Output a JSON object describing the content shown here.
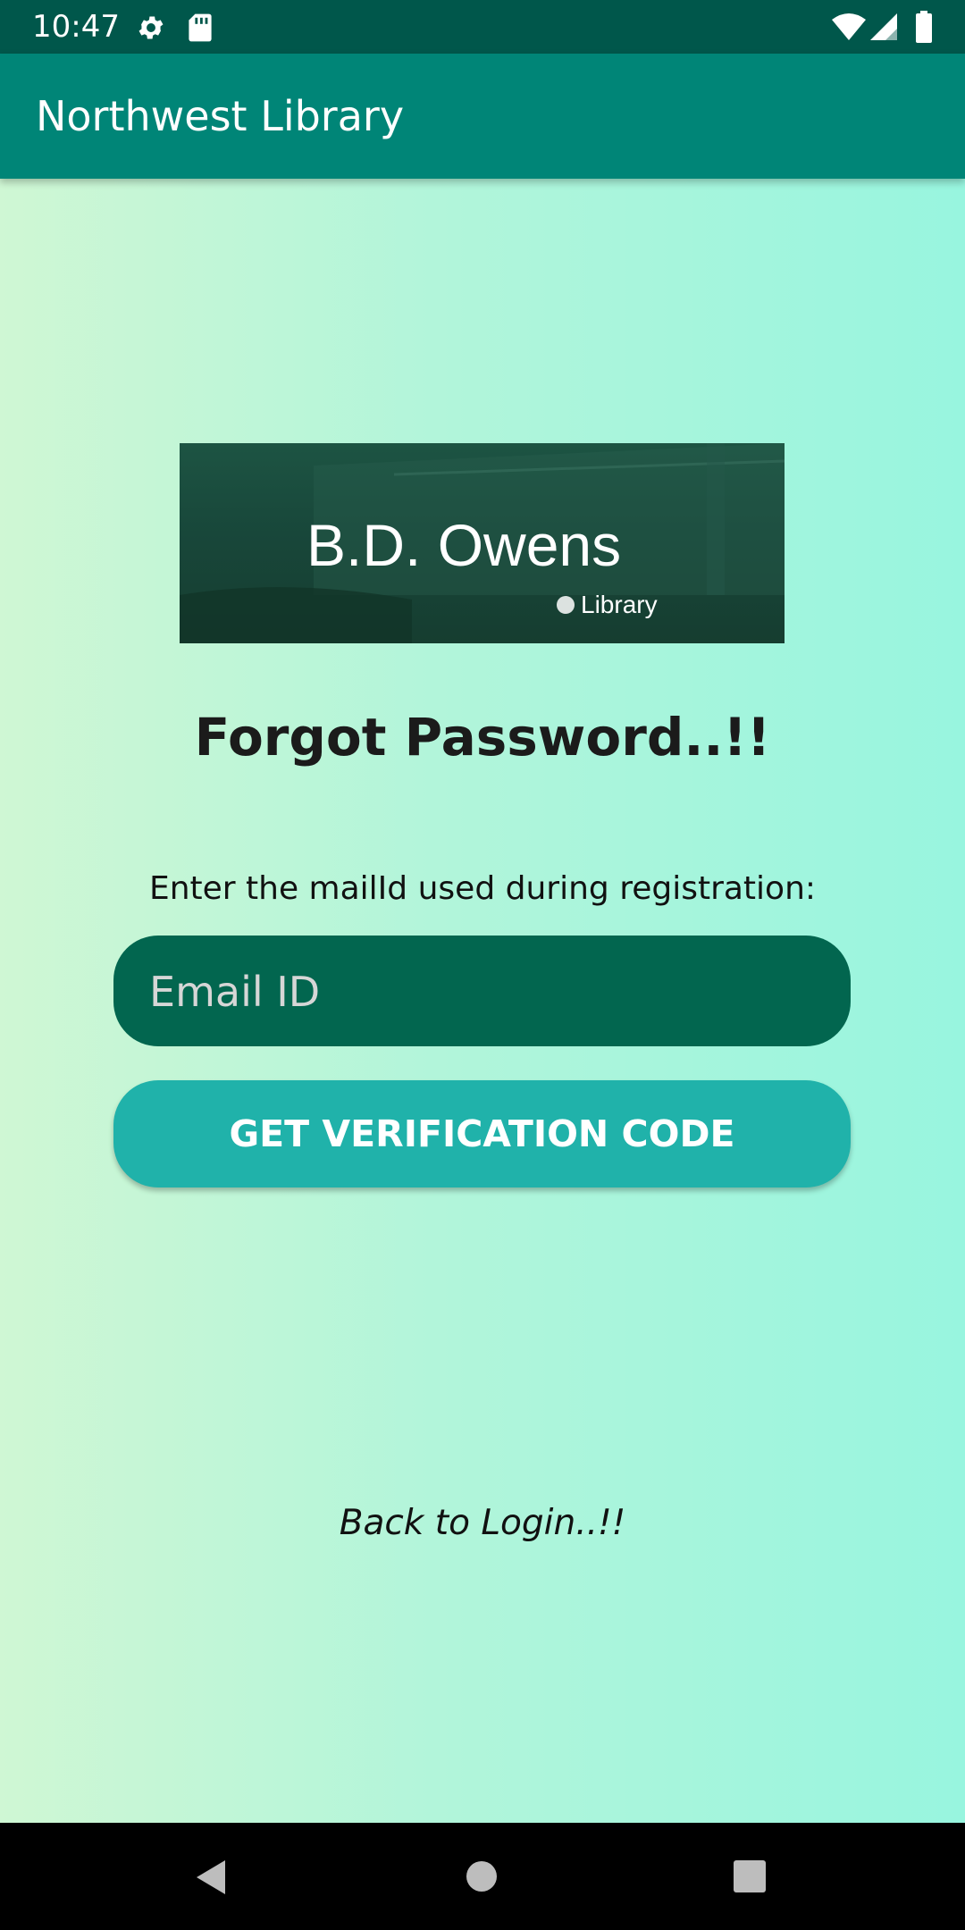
{
  "status_bar": {
    "time": "10:47",
    "icons": [
      "gear-icon",
      "sd-card-icon",
      "wifi-icon",
      "cell-signal-icon",
      "battery-icon"
    ]
  },
  "app_bar": {
    "title": "Northwest Library"
  },
  "logo": {
    "text_main": "B.D. Owens",
    "text_sub": "Library"
  },
  "forgot": {
    "heading": "Forgot Password..!!",
    "instruction": "Enter the mailId used during registration:",
    "email_placeholder": "Email ID",
    "button_label": "GET VERIFICATION CODE",
    "back_link": "Back to Login..!!"
  },
  "nav_bar": {
    "icons": [
      "back-icon",
      "home-icon",
      "recents-icon"
    ]
  },
  "colors": {
    "status_bar": "#00574b",
    "app_bar": "#008577",
    "email_field": "#02664f",
    "button": "#20b2aa",
    "gradient_start": "#cff7d4",
    "gradient_end": "#98f5df"
  }
}
